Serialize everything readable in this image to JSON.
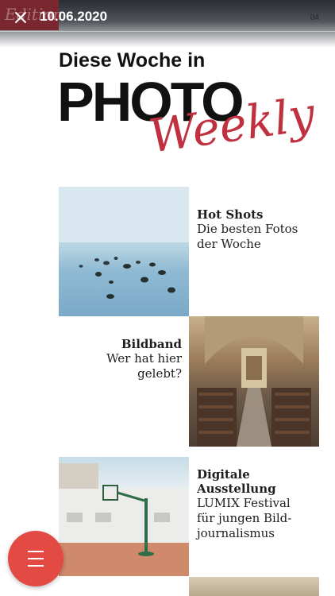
{
  "header": {
    "brand_mark": "Edition",
    "date": "10.06.2020",
    "page_number": "04"
  },
  "masthead": {
    "line1": "Diese Woche in",
    "photo": "PHOTO",
    "weekly": "Weekly"
  },
  "articles": [
    {
      "title": "Hot Shots",
      "subtitle_lines": [
        "Die besten Fotos",
        "der Woche"
      ]
    },
    {
      "title": "Bildband",
      "subtitle_lines": [
        "Wer hat hier gelebt?"
      ]
    },
    {
      "title": "Digitale Ausstellung",
      "subtitle_lines": [
        "LUMIX Festival",
        "für jungen Bild-",
        "journalismus"
      ]
    }
  ],
  "icons": {
    "close": "close-icon",
    "menu": "hamburger-menu-icon"
  },
  "colors": {
    "brand_red": "#c0313f",
    "fab_red": "#e24a43",
    "topbar_dark": "#2a2d33"
  }
}
